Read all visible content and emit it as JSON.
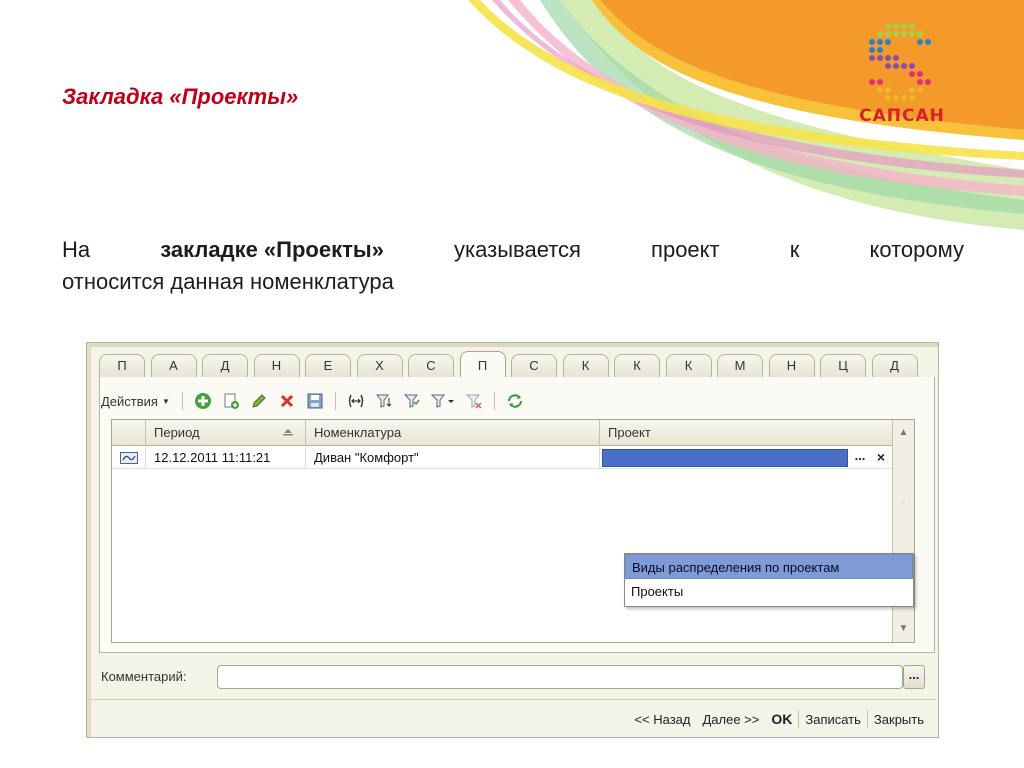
{
  "slide": {
    "title": "Закладка «Проекты»",
    "body_prefix": "На",
    "body_bold": "закладке «Проекты»",
    "body_words": [
      "указывается",
      "проект",
      "к",
      "которому"
    ],
    "body_line2": "относится данная номенклатура"
  },
  "logo": {
    "text": "САПСАН"
  },
  "window": {
    "tabs": [
      {
        "label": "П",
        "active": false
      },
      {
        "label": "А",
        "active": false
      },
      {
        "label": "Д",
        "active": false
      },
      {
        "label": "Н",
        "active": false
      },
      {
        "label": "Е",
        "active": false
      },
      {
        "label": "Х",
        "active": false
      },
      {
        "label": "С",
        "active": false
      },
      {
        "label": "П",
        "active": true
      },
      {
        "label": "С",
        "active": false
      },
      {
        "label": "К",
        "active": false
      },
      {
        "label": "К",
        "active": false
      },
      {
        "label": "К",
        "active": false
      },
      {
        "label": "М",
        "active": false
      },
      {
        "label": "Н",
        "active": false
      },
      {
        "label": "Ц",
        "active": false
      },
      {
        "label": "Д",
        "active": false
      }
    ],
    "toolbar": {
      "actions_label": "Действия",
      "buttons": [
        "add-icon",
        "copy-icon",
        "edit-icon",
        "delete-icon",
        "save-icon",
        "range-icon",
        "filter-set-icon",
        "filter-icon",
        "filter-dropdown-icon",
        "filter-clear-icon",
        "refresh-icon"
      ]
    },
    "grid": {
      "columns": [
        "Период",
        "Номенклатура",
        "Проект"
      ],
      "rows": [
        {
          "period": "12.12.2011 11:11:21",
          "nomenclature": "Диван \"Комфорт\"",
          "project": ""
        }
      ],
      "dots_label": "...",
      "clear_label": "×"
    },
    "dropdown": {
      "items": [
        "Виды распределения по проектам",
        "Проекты"
      ],
      "selected_index": 0
    },
    "comment": {
      "label": "Комментарий:",
      "value": "",
      "dots_label": "..."
    },
    "footer": {
      "back": "<< Назад",
      "next": "Далее >>",
      "ok": "OK",
      "save": "Записать",
      "close": "Закрыть"
    }
  }
}
